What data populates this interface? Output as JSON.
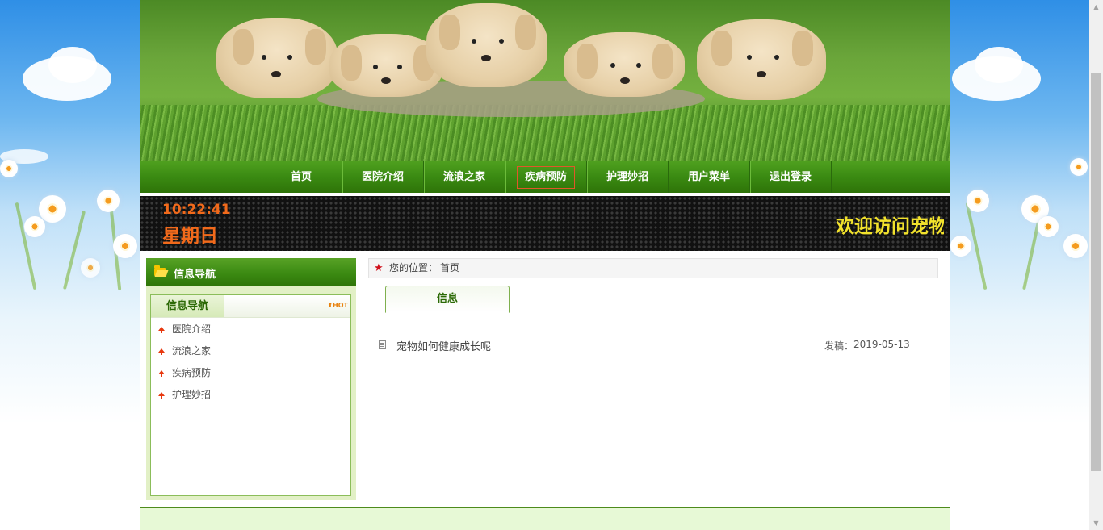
{
  "nav": {
    "items": [
      {
        "label": "首页"
      },
      {
        "label": "医院介绍"
      },
      {
        "label": "流浪之家"
      },
      {
        "label": "疾病预防"
      },
      {
        "label": "护理妙招"
      },
      {
        "label": "用户菜单"
      },
      {
        "label": "退出登录"
      }
    ],
    "active_index": 3
  },
  "clock": {
    "time": "10:22:41",
    "weekday": "星期日"
  },
  "marquee": {
    "text": "欢迎访问宠物"
  },
  "sidebar": {
    "title": "信息导航",
    "box_tab": "信息导航",
    "hot_label": "HOT",
    "items": [
      {
        "label": "医院介绍"
      },
      {
        "label": "流浪之家"
      },
      {
        "label": "疾病预防"
      },
      {
        "label": "护理妙招"
      }
    ]
  },
  "breadcrumb": {
    "label": "您的位置：",
    "home": "首页"
  },
  "main": {
    "tab": "信息",
    "rows": [
      {
        "title": "宠物如何健康成长呢",
        "date_label": "发稿：",
        "date": "2019-05-13"
      }
    ]
  },
  "colors": {
    "nav_green": "#3a8a12",
    "clock_orange": "#f26a1b",
    "marquee_yellow": "#f2e22c",
    "accent_red": "#d0101b"
  }
}
